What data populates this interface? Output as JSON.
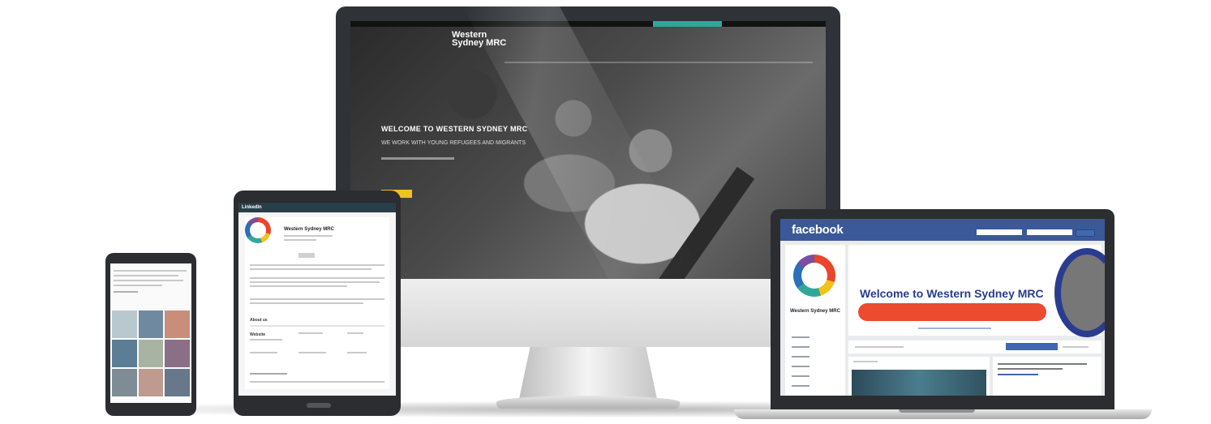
{
  "scene": {
    "colors": {
      "brand_red": "#ec4b2f",
      "brand_navy": "#2a3c8f",
      "brand_teal": "#2fa89a",
      "brand_yellow": "#f1c21b",
      "facebook_blue": "#3b5998",
      "linkedin_navy": "#283e4a"
    }
  },
  "desktop": {
    "logo_line1": "Western",
    "logo_line2": "Sydney MRC",
    "hero_title": "WELCOME TO WESTERN SYDNEY MRC",
    "hero_subtitle": "WE WORK WITH YOUNG REFUGEES AND MIGRANTS"
  },
  "tablet": {
    "app_bar_title": "LinkedIn",
    "company_name": "Western Sydney MRC",
    "section_about": "About us",
    "section_details": "Website"
  },
  "laptop": {
    "fb_logo": "facebook",
    "page_name": "Western Sydney MRC",
    "welcome_heading": "Welcome to Western Sydney MRC"
  }
}
